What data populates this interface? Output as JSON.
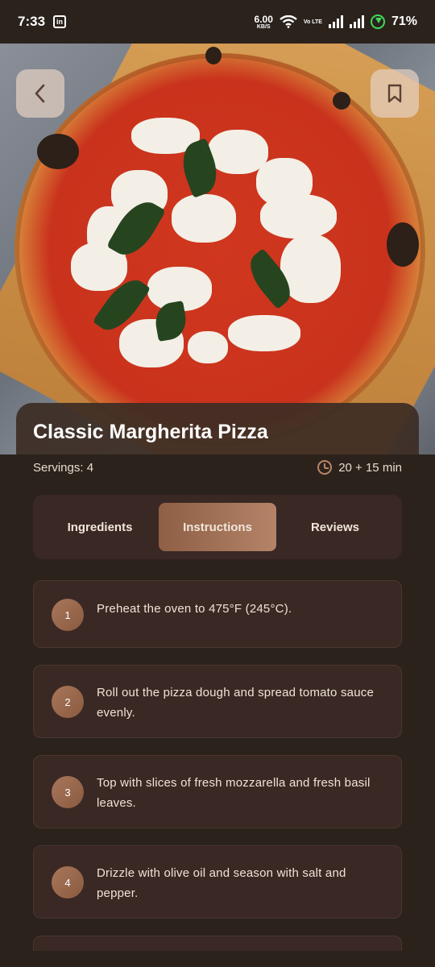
{
  "status_bar": {
    "time": "7:33",
    "app_icon": "in",
    "net_speed": "6.00",
    "net_unit": "KB/S",
    "volte": "Vo LTE",
    "battery": "71%"
  },
  "hero": {
    "title": "Classic Margherita Pizza"
  },
  "meta": {
    "servings": "Servings: 4",
    "time": "20 + 15 min"
  },
  "tabs": [
    {
      "label": "Ingredients",
      "active": false
    },
    {
      "label": "Instructions",
      "active": true
    },
    {
      "label": "Reviews",
      "active": false
    }
  ],
  "steps": [
    {
      "number": "1",
      "text": "Preheat the oven to 475°F (245°C)."
    },
    {
      "number": "2",
      "text": "Roll out the pizza dough and spread tomato sauce evenly."
    },
    {
      "number": "3",
      "text": "Top with slices of fresh mozzarella and fresh basil leaves."
    },
    {
      "number": "4",
      "text": "Drizzle with olive oil and season with salt and pepper."
    }
  ],
  "colors": {
    "background": "#2b221c",
    "card": "#3a2824",
    "accent": "#b48368"
  }
}
